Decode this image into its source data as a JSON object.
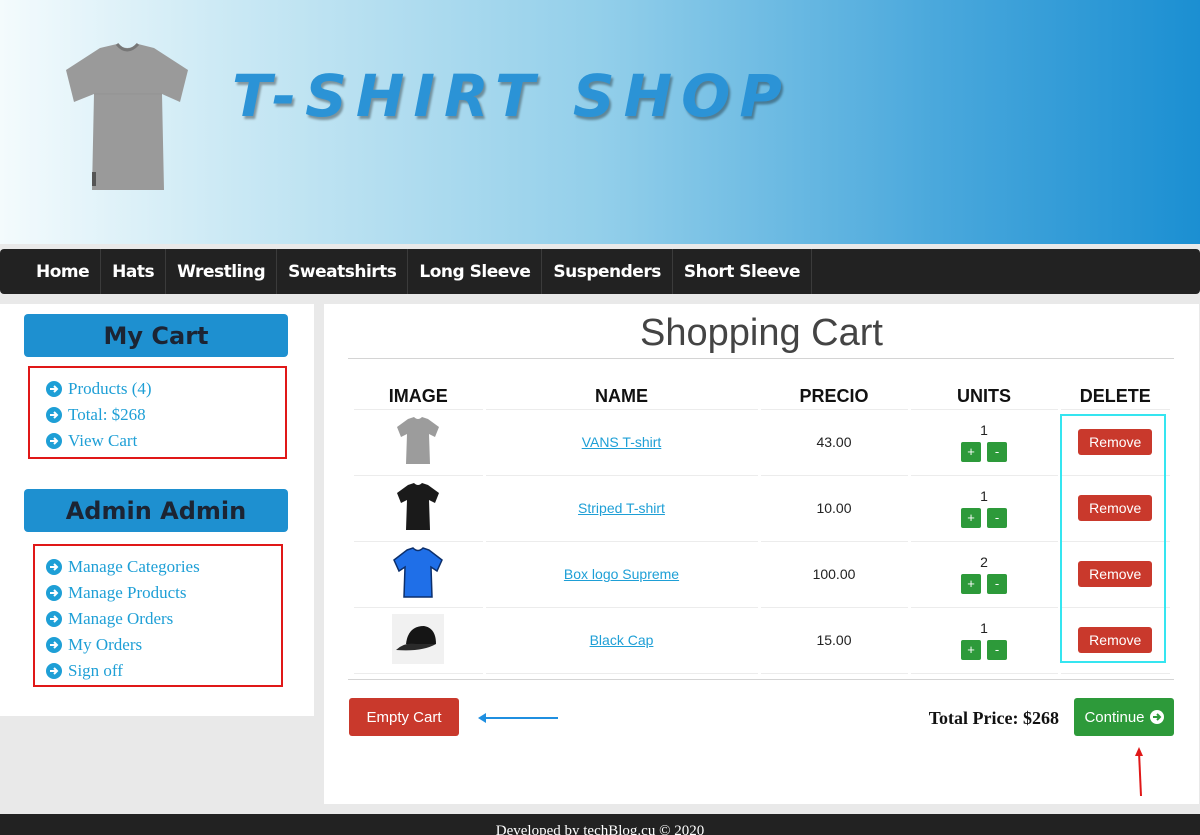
{
  "header": {
    "shop_title": "T-SHIRT SHOP"
  },
  "nav": {
    "items": [
      "Home",
      "Hats",
      "Wrestling",
      "Sweatshirts",
      "Long Sleeve",
      "Suspenders",
      "Short Sleeve"
    ]
  },
  "sidebar": {
    "cart": {
      "heading": "My Cart",
      "links": [
        "Products (4)",
        "Total: $268",
        "View Cart"
      ]
    },
    "admin": {
      "heading": "Admin Admin",
      "links": [
        "Manage Categories",
        "Manage Products",
        "Manage Orders",
        "My Orders",
        "Sign off"
      ]
    }
  },
  "main": {
    "title": "Shopping Cart",
    "columns": [
      "IMAGE",
      "NAME",
      "PRECIO",
      "UNITS",
      "DELETE"
    ],
    "rows": [
      {
        "name": "VANS T-shirt",
        "price": "43.00",
        "units": "1",
        "image_icon": "grey-tshirt-icon"
      },
      {
        "name": "Striped T-shirt",
        "price": "10.00",
        "units": "1",
        "image_icon": "black-tshirt-icon"
      },
      {
        "name": "Box logo Supreme",
        "price": "100.00",
        "units": "2",
        "image_icon": "blue-tshirt-icon"
      },
      {
        "name": "Black Cap",
        "price": "15.00",
        "units": "1",
        "image_icon": "black-cap-icon"
      }
    ],
    "plus_label": "+",
    "minus_label": "-",
    "remove_label": "Remove",
    "empty_cart_label": "Empty Cart",
    "total_price": "Total Price: $268",
    "continue_label": "Continue"
  },
  "footer": {
    "text": "Developed by techBlog.cu © 2020"
  },
  "colors": {
    "accent": "#1e90d0",
    "link": "#1e9fd6",
    "danger": "#c9392c",
    "success": "#2d9a3a",
    "nav_bg": "#222222",
    "annotation_red": "#e01818",
    "annotation_cyan": "#35e5f0",
    "annotation_blue_arrow": "#1f8fe0"
  }
}
